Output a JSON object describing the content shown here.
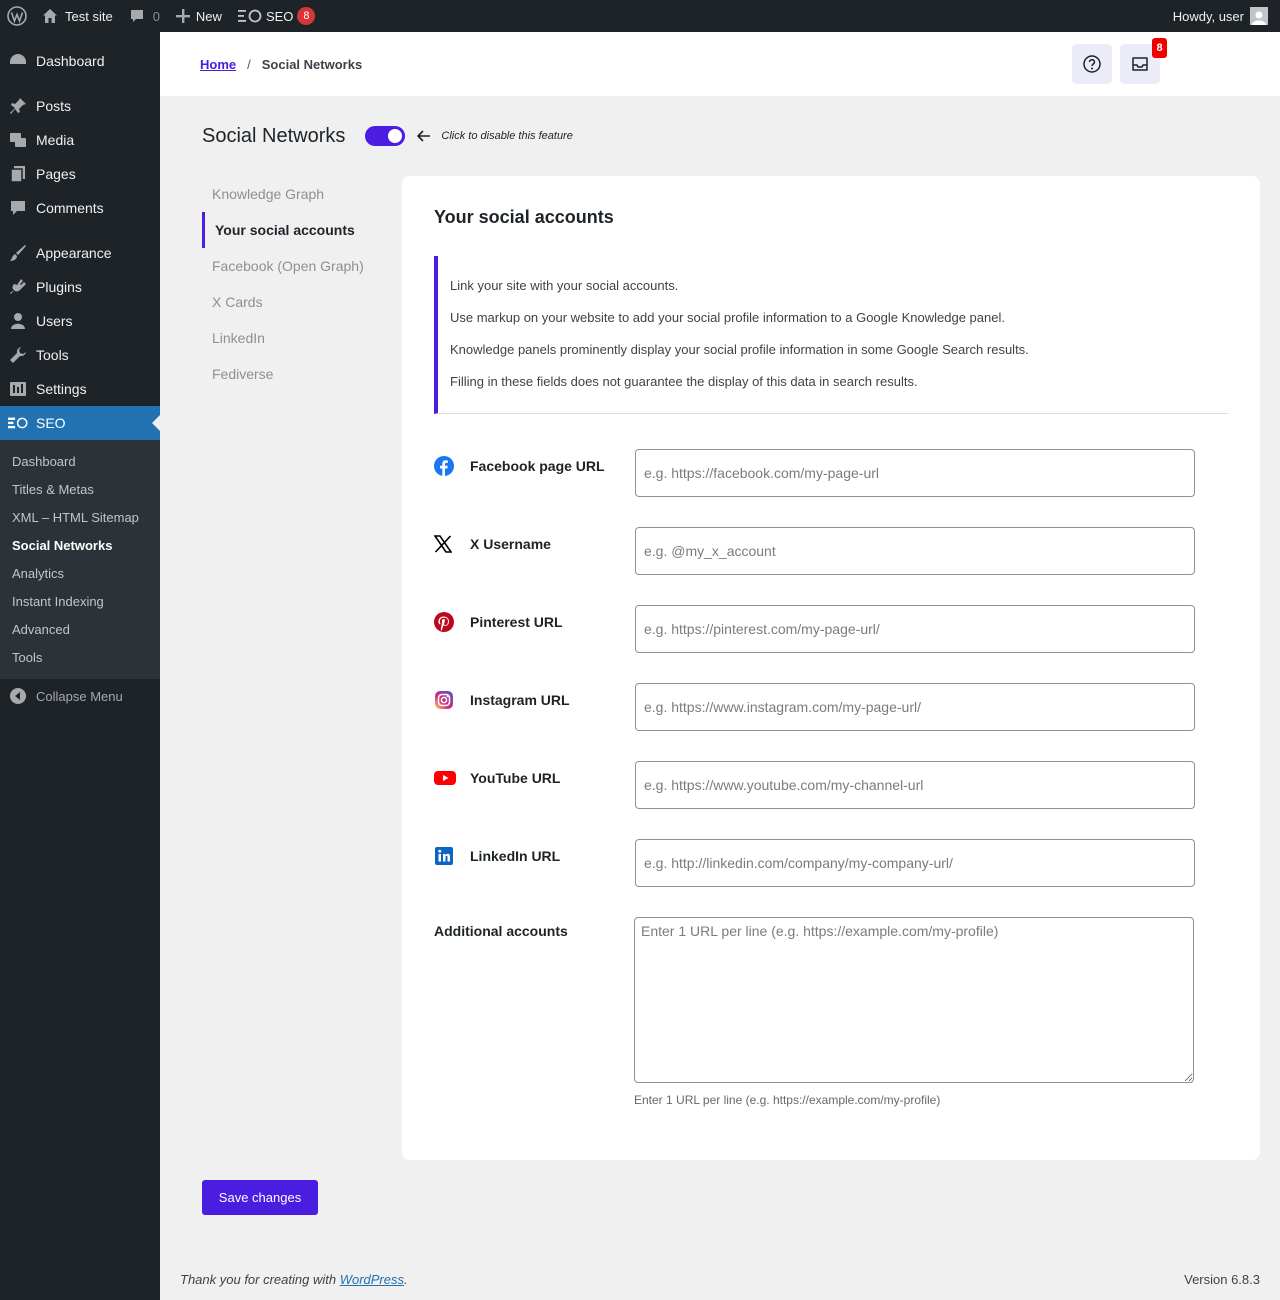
{
  "admin_bar": {
    "site_name": "Test site",
    "comments_count": "0",
    "new_label": "New",
    "seo_label": "SEO",
    "seo_badge": "8",
    "howdy": "Howdy, user"
  },
  "sidebar": {
    "items": [
      {
        "label": "Dashboard",
        "icon": "dashboard-icon"
      },
      {
        "label": "Posts",
        "icon": "pin-icon"
      },
      {
        "label": "Media",
        "icon": "media-icon"
      },
      {
        "label": "Pages",
        "icon": "pages-icon"
      },
      {
        "label": "Comments",
        "icon": "comment-icon"
      },
      {
        "label": "Appearance",
        "icon": "brush-icon"
      },
      {
        "label": "Plugins",
        "icon": "plugin-icon"
      },
      {
        "label": "Users",
        "icon": "user-icon"
      },
      {
        "label": "Tools",
        "icon": "wrench-icon"
      },
      {
        "label": "Settings",
        "icon": "settings-icon"
      },
      {
        "label": "SEO",
        "icon": "seo-icon"
      }
    ],
    "submenu": [
      "Dashboard",
      "Titles & Metas",
      "XML – HTML Sitemap",
      "Social Networks",
      "Analytics",
      "Instant Indexing",
      "Advanced",
      "Tools"
    ],
    "collapse_label": "Collapse Menu"
  },
  "header": {
    "breadcrumb_home": "Home",
    "breadcrumb_sep": "/",
    "breadcrumb_current": "Social Networks",
    "notifications_badge": "8"
  },
  "page": {
    "title": "Social Networks",
    "toggle_on": true,
    "toggle_hint": "Click to disable this feature"
  },
  "subnav": [
    "Knowledge Graph",
    "Your social accounts",
    "Facebook (Open Graph)",
    "X Cards",
    "LinkedIn",
    "Fediverse"
  ],
  "card": {
    "title": "Your social accounts",
    "notice": [
      "Link your site with your social accounts.",
      "Use markup on your website to add your social profile information to a Google Knowledge panel.",
      "Knowledge panels prominently display your social profile information in some Google Search results.",
      "Filling in these fields does not guarantee the display of this data in search results."
    ],
    "fields": [
      {
        "label": "Facebook page URL",
        "placeholder": "e.g. https://facebook.com/my-page-url",
        "value": "",
        "icon": "facebook-icon"
      },
      {
        "label": "X Username",
        "placeholder": "e.g. @my_x_account",
        "value": "",
        "icon": "x-icon"
      },
      {
        "label": "Pinterest URL",
        "placeholder": "e.g. https://pinterest.com/my-page-url/",
        "value": "",
        "icon": "pinterest-icon"
      },
      {
        "label": "Instagram URL",
        "placeholder": "e.g. https://www.instagram.com/my-page-url/",
        "value": "",
        "icon": "instagram-icon"
      },
      {
        "label": "YouTube URL",
        "placeholder": "e.g. https://www.youtube.com/my-channel-url",
        "value": "",
        "icon": "youtube-icon"
      },
      {
        "label": "LinkedIn URL",
        "placeholder": "e.g. http://linkedin.com/company/my-company-url/",
        "value": "",
        "icon": "linkedin-icon"
      }
    ],
    "additional_label": "Additional accounts",
    "additional_placeholder": "Enter 1 URL per line (e.g. https://example.com/my-profile)",
    "additional_help": "Enter 1 URL per line (e.g. https://example.com/my-profile)"
  },
  "save_label": "Save changes",
  "footer": {
    "thanks_prefix": "Thank you for creating with ",
    "thanks_link": "WordPress",
    "thanks_suffix": ".",
    "version": "Version 6.8.3"
  },
  "colors": {
    "accent": "#4a1de0",
    "admin_dark": "#1d2327",
    "wp_blue": "#2271b1",
    "badge_red": "#d63638"
  }
}
